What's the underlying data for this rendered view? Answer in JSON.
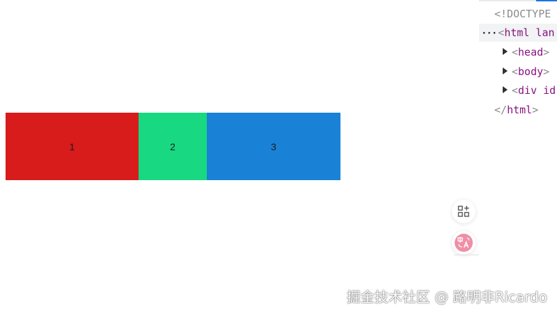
{
  "flex_demo": {
    "items": [
      {
        "label": "1",
        "color": "#d81b1b"
      },
      {
        "label": "2",
        "color": "#18d882"
      },
      {
        "label": "3",
        "color": "#1a82d6"
      }
    ]
  },
  "devtools": {
    "lines": [
      {
        "text": "<!DOCTYPE"
      },
      {
        "open": "<",
        "tag": "html",
        "rest": " lan"
      },
      {
        "open": "<",
        "tag": "head",
        "close": ">"
      },
      {
        "open": "<",
        "tag": "body",
        "close": ">"
      },
      {
        "open": "<",
        "tag": "div",
        "rest": " id"
      },
      {
        "open": "</",
        "tag": "html",
        "close": ">"
      }
    ]
  },
  "floating_buttons": {
    "grid_icon": "grid-plus-icon",
    "translate_icon": "translate-icon"
  },
  "watermark": {
    "text": "掘金技术社区 @ 路明非Ricardo"
  }
}
